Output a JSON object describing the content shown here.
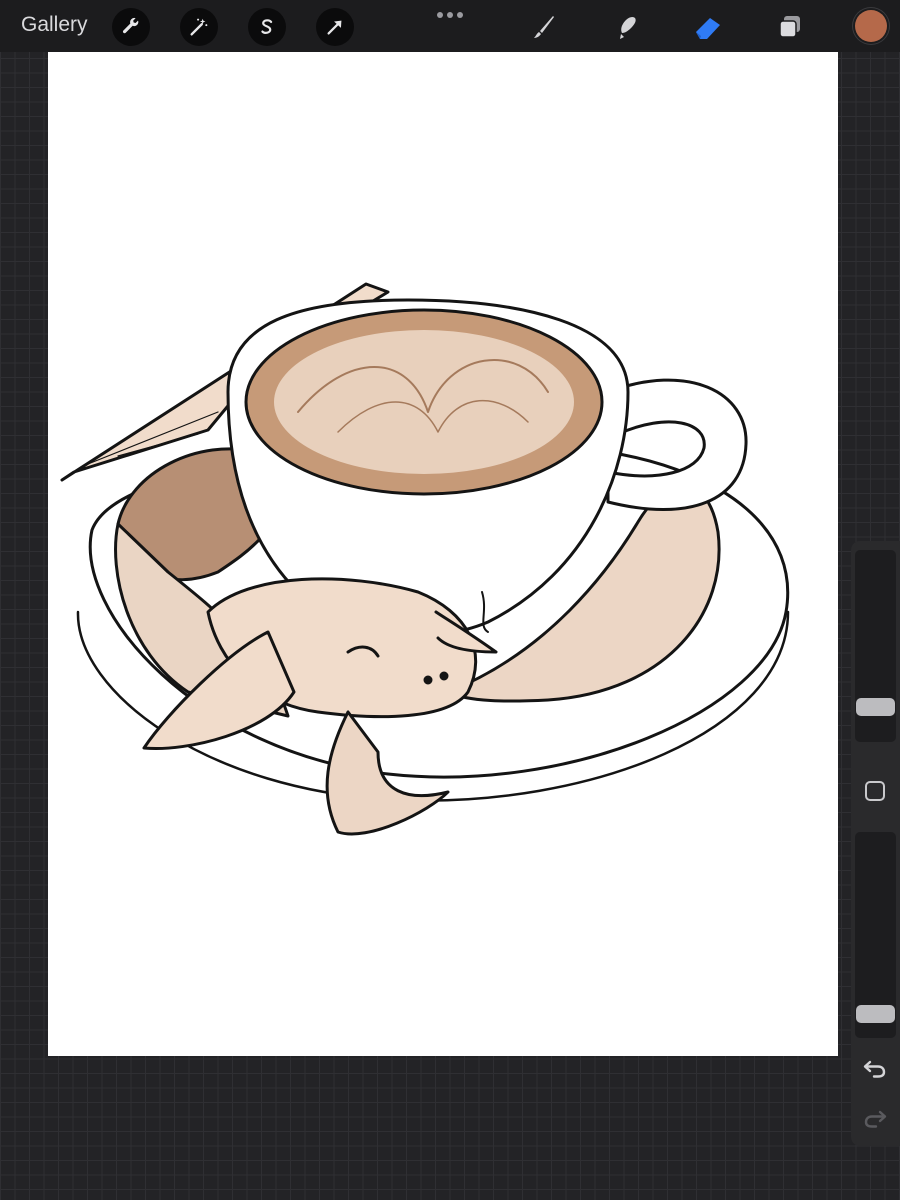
{
  "toolbar": {
    "gallery_label": "Gallery",
    "left_tools": [
      {
        "icon": "wrench-icon"
      },
      {
        "icon": "magic-wand-icon"
      },
      {
        "icon": "selection-icon"
      },
      {
        "icon": "transform-arrow-icon"
      }
    ],
    "right_tools": [
      {
        "icon": "brush-icon"
      },
      {
        "icon": "smudge-icon"
      },
      {
        "icon": "eraser-icon",
        "active": true
      },
      {
        "icon": "layers-icon"
      }
    ],
    "active_color": "#B5694A",
    "accent_color": "#2F7BF5"
  },
  "sidebar": {
    "brush_size": 0.15,
    "opacity": 0.08,
    "modify_icon": "square-icon",
    "undo_icon": "undo-arrow-icon",
    "redo_icon": "redo-arrow-icon"
  },
  "canvas": {
    "artwork": "dragon-latte-illustration"
  }
}
